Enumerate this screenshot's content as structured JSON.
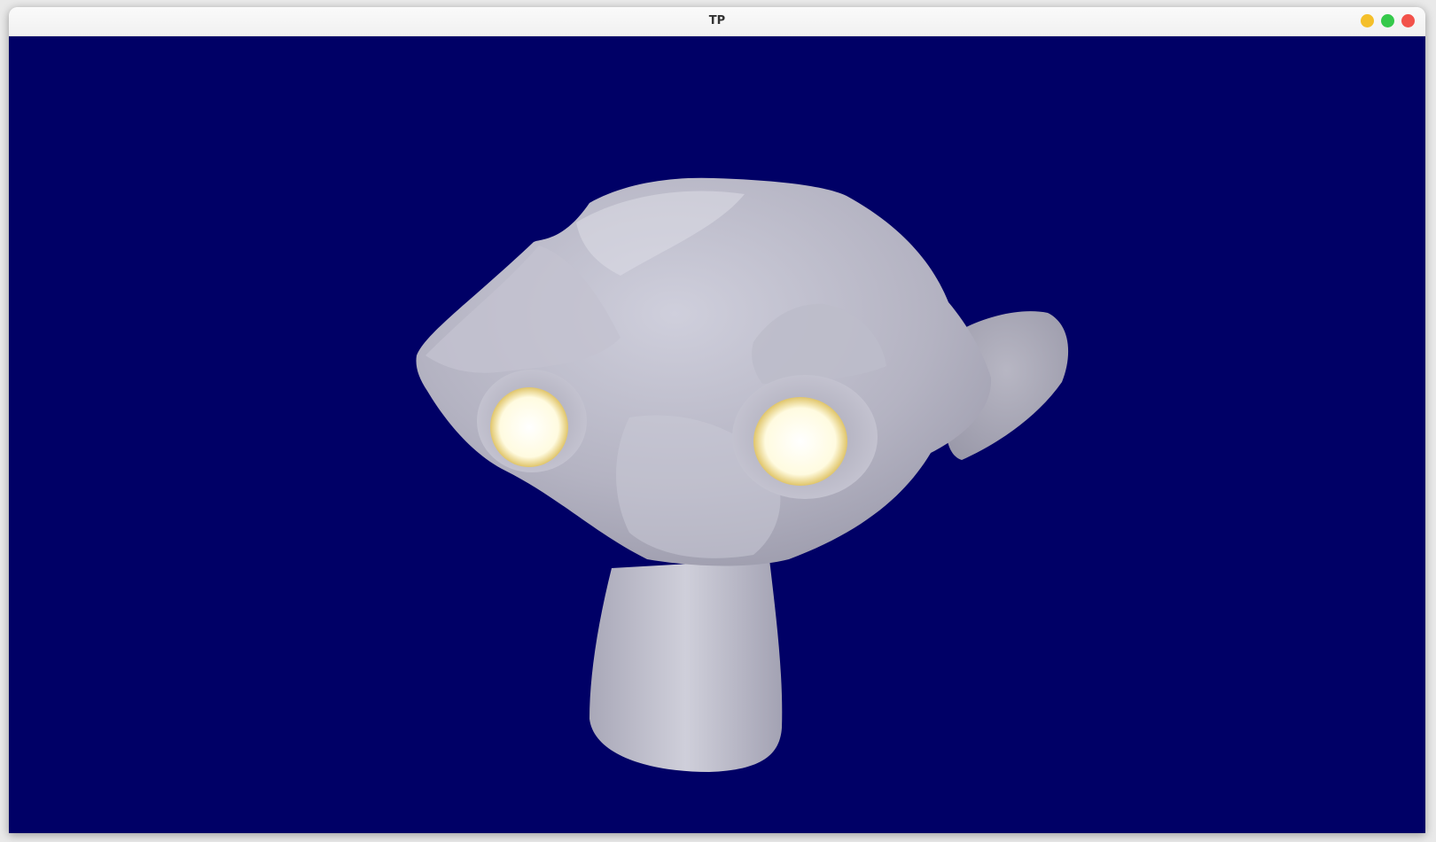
{
  "window": {
    "title": "TP",
    "controls": [
      {
        "name": "minimize",
        "color": "#f4bf2a"
      },
      {
        "name": "maximize",
        "color": "#35c94b"
      },
      {
        "name": "close",
        "color": "#f2524a"
      }
    ]
  },
  "scene": {
    "background_color": "#000066",
    "object": "suzanne-monkey-head",
    "material_color": "#b9b8c7",
    "eye_glow_color": "#fffbe0"
  }
}
